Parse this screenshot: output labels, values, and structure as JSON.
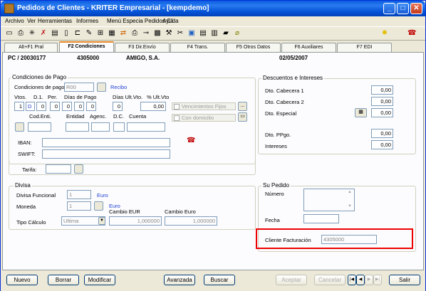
{
  "window": {
    "title": "Pedidos de Clientes - KRITER Empresarial - [kempdemo]",
    "minimize": "_",
    "maximize": "□",
    "close": "✕"
  },
  "menu": [
    "Archivo",
    "Ver",
    "Herramientas",
    "Informes",
    "Menú Especia Pedidos Cli",
    "Ayuda"
  ],
  "tabs": [
    "Alt+F1 Pral",
    "F2 Condiciones",
    "F3 Dir.Envío",
    "F4 Trans.",
    "F5 Otros Datos",
    "F6 Auxiliares",
    "F7 EDI"
  ],
  "header": {
    "order": "PC / 20030177",
    "client_code": "4305000",
    "client_name": "AMIGO, S.A.",
    "date": "02/05/2007"
  },
  "condiciones": {
    "group_label": "Condiciones de Pago",
    "cond_pago_label": "Condiciones de pago",
    "cond_pago_value": "R00",
    "cond_pago_name": "Recibo",
    "col_vtos": "Vtos.",
    "col_d1": "D.1.",
    "col_per": "Per.",
    "col_dias": "Días de Pago",
    "col_dias_ult": "Días Ult.Vto.",
    "col_pct": "% Ult.Vto",
    "vtos": "1",
    "d1": "D",
    "per": "0",
    "dias": [
      "0",
      "0",
      "0",
      "0"
    ],
    "dias_ult": "0",
    "pct": "0,00",
    "venc_fijos": "Vencimientos Fijos",
    "con_domicilio": "Con domicilio",
    "col_codent": "Cod.Enti.",
    "col_entidad": "Entidad",
    "col_agenc": "Agenc.",
    "col_dc": "D.C.",
    "col_cuenta": "Cuenta",
    "iban_label": "IBAN:",
    "swift_label": "SWIFT:",
    "tarifa_label": "Tarifa:",
    "ellipsis": "..."
  },
  "descuentos": {
    "group_label": "Descuentos e Intereses",
    "items": [
      {
        "label": "Dto. Cabecera 1",
        "value": "0,00"
      },
      {
        "label": "Dto. Cabecera 2",
        "value": "0,00"
      },
      {
        "label": "Dto. Especial",
        "value": "0,00"
      },
      {
        "label": "Dto. PPgo.",
        "value": "0,00"
      },
      {
        "label": "Intereses",
        "value": "0,00"
      }
    ]
  },
  "divisa": {
    "group_label": "Divisa",
    "funcional_label": "Divisa Funcional",
    "funcional_value": "1",
    "funcional_name": "Euro",
    "moneda_label": "Moneda",
    "moneda_value": "1",
    "moneda_name": "Euro",
    "tipo_label": "Tipo Cálculo",
    "tipo_value": "Ultima",
    "cambio_eur_label": "Cambio EUR",
    "cambio_eur_value": "1,000000",
    "cambio_euro_label": "Cambio Euro",
    "cambio_euro_value": "1,000000"
  },
  "su_pedido": {
    "group_label": "Su Pedido",
    "numero_label": "Número",
    "fecha_label": "Fecha",
    "cliente_fact_label": "Cliente Facturación",
    "cliente_fact_value": "4305000"
  },
  "buttons": {
    "nuevo": "Nuevo",
    "borrar": "Borrar",
    "modificar": "Modificar",
    "avanzada": "Avanzada",
    "buscar": "Buscar",
    "aceptar": "Aceptar",
    "cancelar": "Cancelar",
    "salir": "Salir"
  },
  "nav": {
    "first": "|◀",
    "prev": "◀",
    "next": "▶",
    "last": "▶|"
  }
}
